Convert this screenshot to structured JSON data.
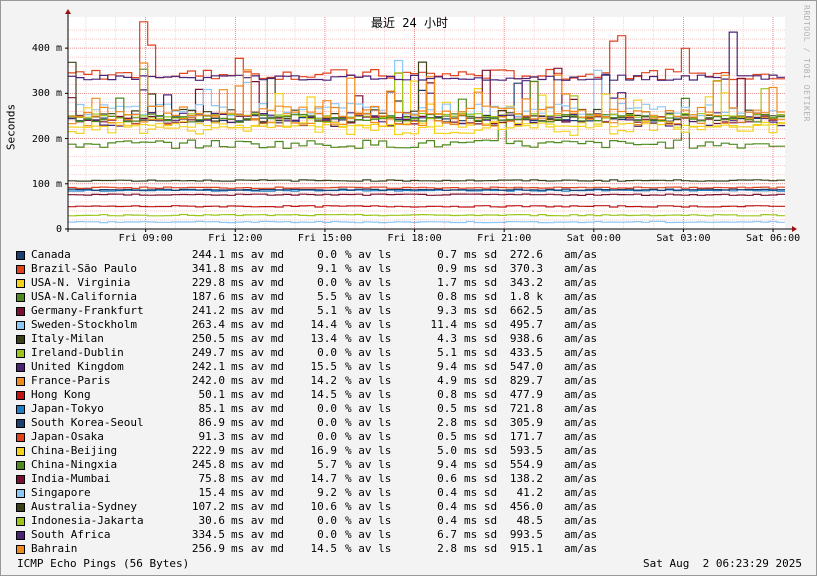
{
  "title": "最近 24 小时",
  "side_label": "RRDTOOL / TOBI OETIKER",
  "footer_left": "ICMP Echo Pings (56 Bytes)",
  "footer_right": "Sat Aug  2 06:23:29 2025",
  "chart_data": {
    "type": "line",
    "title": "最近 24 小时",
    "ylabel": "Seconds",
    "y_unit": "m",
    "ylim": [
      0,
      0.46
    ],
    "y_ticks": [
      {
        "value": 0,
        "label": "0"
      },
      {
        "value": 0.1,
        "label": "100 m"
      },
      {
        "value": 0.2,
        "label": "200 m"
      },
      {
        "value": 0.3,
        "label": "300 m"
      },
      {
        "value": 0.4,
        "label": "400 m"
      }
    ],
    "x_range_hours": [
      6.4,
      30.4
    ],
    "x_ticks": [
      {
        "hour": 9,
        "label": "Fri 09:00"
      },
      {
        "hour": 12,
        "label": "Fri 12:00"
      },
      {
        "hour": 15,
        "label": "Fri 15:00"
      },
      {
        "hour": 18,
        "label": "Fri 18:00"
      },
      {
        "hour": 21,
        "label": "Fri 21:00"
      },
      {
        "hour": 24,
        "label": "Sat 00:00"
      },
      {
        "hour": 27,
        "label": "Sat 03:00"
      },
      {
        "hour": 30,
        "label": "Sat 06:00"
      }
    ],
    "grid": true,
    "legend_position": "bottom",
    "legend_units": {
      "avg": "ms av md",
      "loss": "% av ls",
      "sd": "ms sd",
      "ratio": "am/as"
    },
    "series": [
      {
        "name": "Canada",
        "color": "#1b3f6e",
        "avg": "244.1",
        "loss": "0.0",
        "sd": "0.7",
        "ratio": "272.6"
      },
      {
        "name": "Brazil-São Paulo",
        "color": "#e0421e",
        "avg": "341.8",
        "loss": "9.1",
        "sd": "0.9",
        "ratio": "370.3"
      },
      {
        "name": "USA-N. Virginia",
        "color": "#f2d21b",
        "avg": "229.8",
        "loss": "0.0",
        "sd": "1.7",
        "ratio": "343.2"
      },
      {
        "name": "USA-N.California",
        "color": "#4e8a1f",
        "avg": "187.6",
        "loss": "5.5",
        "sd": "0.8",
        "ratio": "1.8 k"
      },
      {
        "name": "Germany-Frankfurt",
        "color": "#7a1030",
        "avg": "241.2",
        "loss": "5.1",
        "sd": "9.3",
        "ratio": "662.5"
      },
      {
        "name": "Sweden-Stockholm",
        "color": "#8cc8f5",
        "avg": "263.4",
        "loss": "14.4",
        "sd": "11.4",
        "ratio": "495.7"
      },
      {
        "name": "Italy-Milan",
        "color": "#3a4018",
        "avg": "250.5",
        "loss": "13.4",
        "sd": "4.3",
        "ratio": "938.6"
      },
      {
        "name": "Ireland-Dublin",
        "color": "#9cc51c",
        "avg": "249.7",
        "loss": "0.0",
        "sd": "5.1",
        "ratio": "433.5"
      },
      {
        "name": "United Kingdom",
        "color": "#4a2379",
        "avg": "242.1",
        "loss": "15.5",
        "sd": "9.4",
        "ratio": "547.0"
      },
      {
        "name": "France-Paris",
        "color": "#f08a1c",
        "avg": "242.0",
        "loss": "14.2",
        "sd": "4.9",
        "ratio": "829.7"
      },
      {
        "name": "Hong Kong",
        "color": "#c01515",
        "avg": "50.1",
        "loss": "14.5",
        "sd": "0.8",
        "ratio": "477.9"
      },
      {
        "name": "Japan-Tokyo",
        "color": "#1f7fc2",
        "avg": "85.1",
        "loss": "0.0",
        "sd": "0.5",
        "ratio": "721.8"
      },
      {
        "name": "South Korea-Seoul",
        "color": "#1b3f6e",
        "avg": "86.9",
        "loss": "0.0",
        "sd": "2.8",
        "ratio": "305.9"
      },
      {
        "name": "Japan-Osaka",
        "color": "#e0421e",
        "avg": "91.3",
        "loss": "0.0",
        "sd": "0.5",
        "ratio": "171.7"
      },
      {
        "name": "China-Beijing",
        "color": "#f2d21b",
        "avg": "222.9",
        "loss": "16.9",
        "sd": "5.0",
        "ratio": "593.5"
      },
      {
        "name": "China-Ningxia",
        "color": "#4e8a1f",
        "avg": "245.8",
        "loss": "5.7",
        "sd": "9.4",
        "ratio": "554.9"
      },
      {
        "name": "India-Mumbai",
        "color": "#7a1030",
        "avg": "75.8",
        "loss": "14.7",
        "sd": "0.6",
        "ratio": "138.2"
      },
      {
        "name": "Singapore",
        "color": "#8cc8f5",
        "avg": "15.4",
        "loss": "9.2",
        "sd": "0.4",
        "ratio": "41.2"
      },
      {
        "name": "Australia-Sydney",
        "color": "#3a4018",
        "avg": "107.2",
        "loss": "10.6",
        "sd": "0.4",
        "ratio": "456.0"
      },
      {
        "name": "Indonesia-Jakarta",
        "color": "#9cc51c",
        "avg": "30.6",
        "loss": "0.0",
        "sd": "0.4",
        "ratio": "48.5"
      },
      {
        "name": "South Africa",
        "color": "#4a2379",
        "avg": "334.5",
        "loss": "0.0",
        "sd": "6.7",
        "ratio": "993.5"
      },
      {
        "name": "Bahrain",
        "color": "#f08a1c",
        "avg": "256.9",
        "loss": "14.5",
        "sd": "2.8",
        "ratio": "915.1"
      }
    ]
  }
}
